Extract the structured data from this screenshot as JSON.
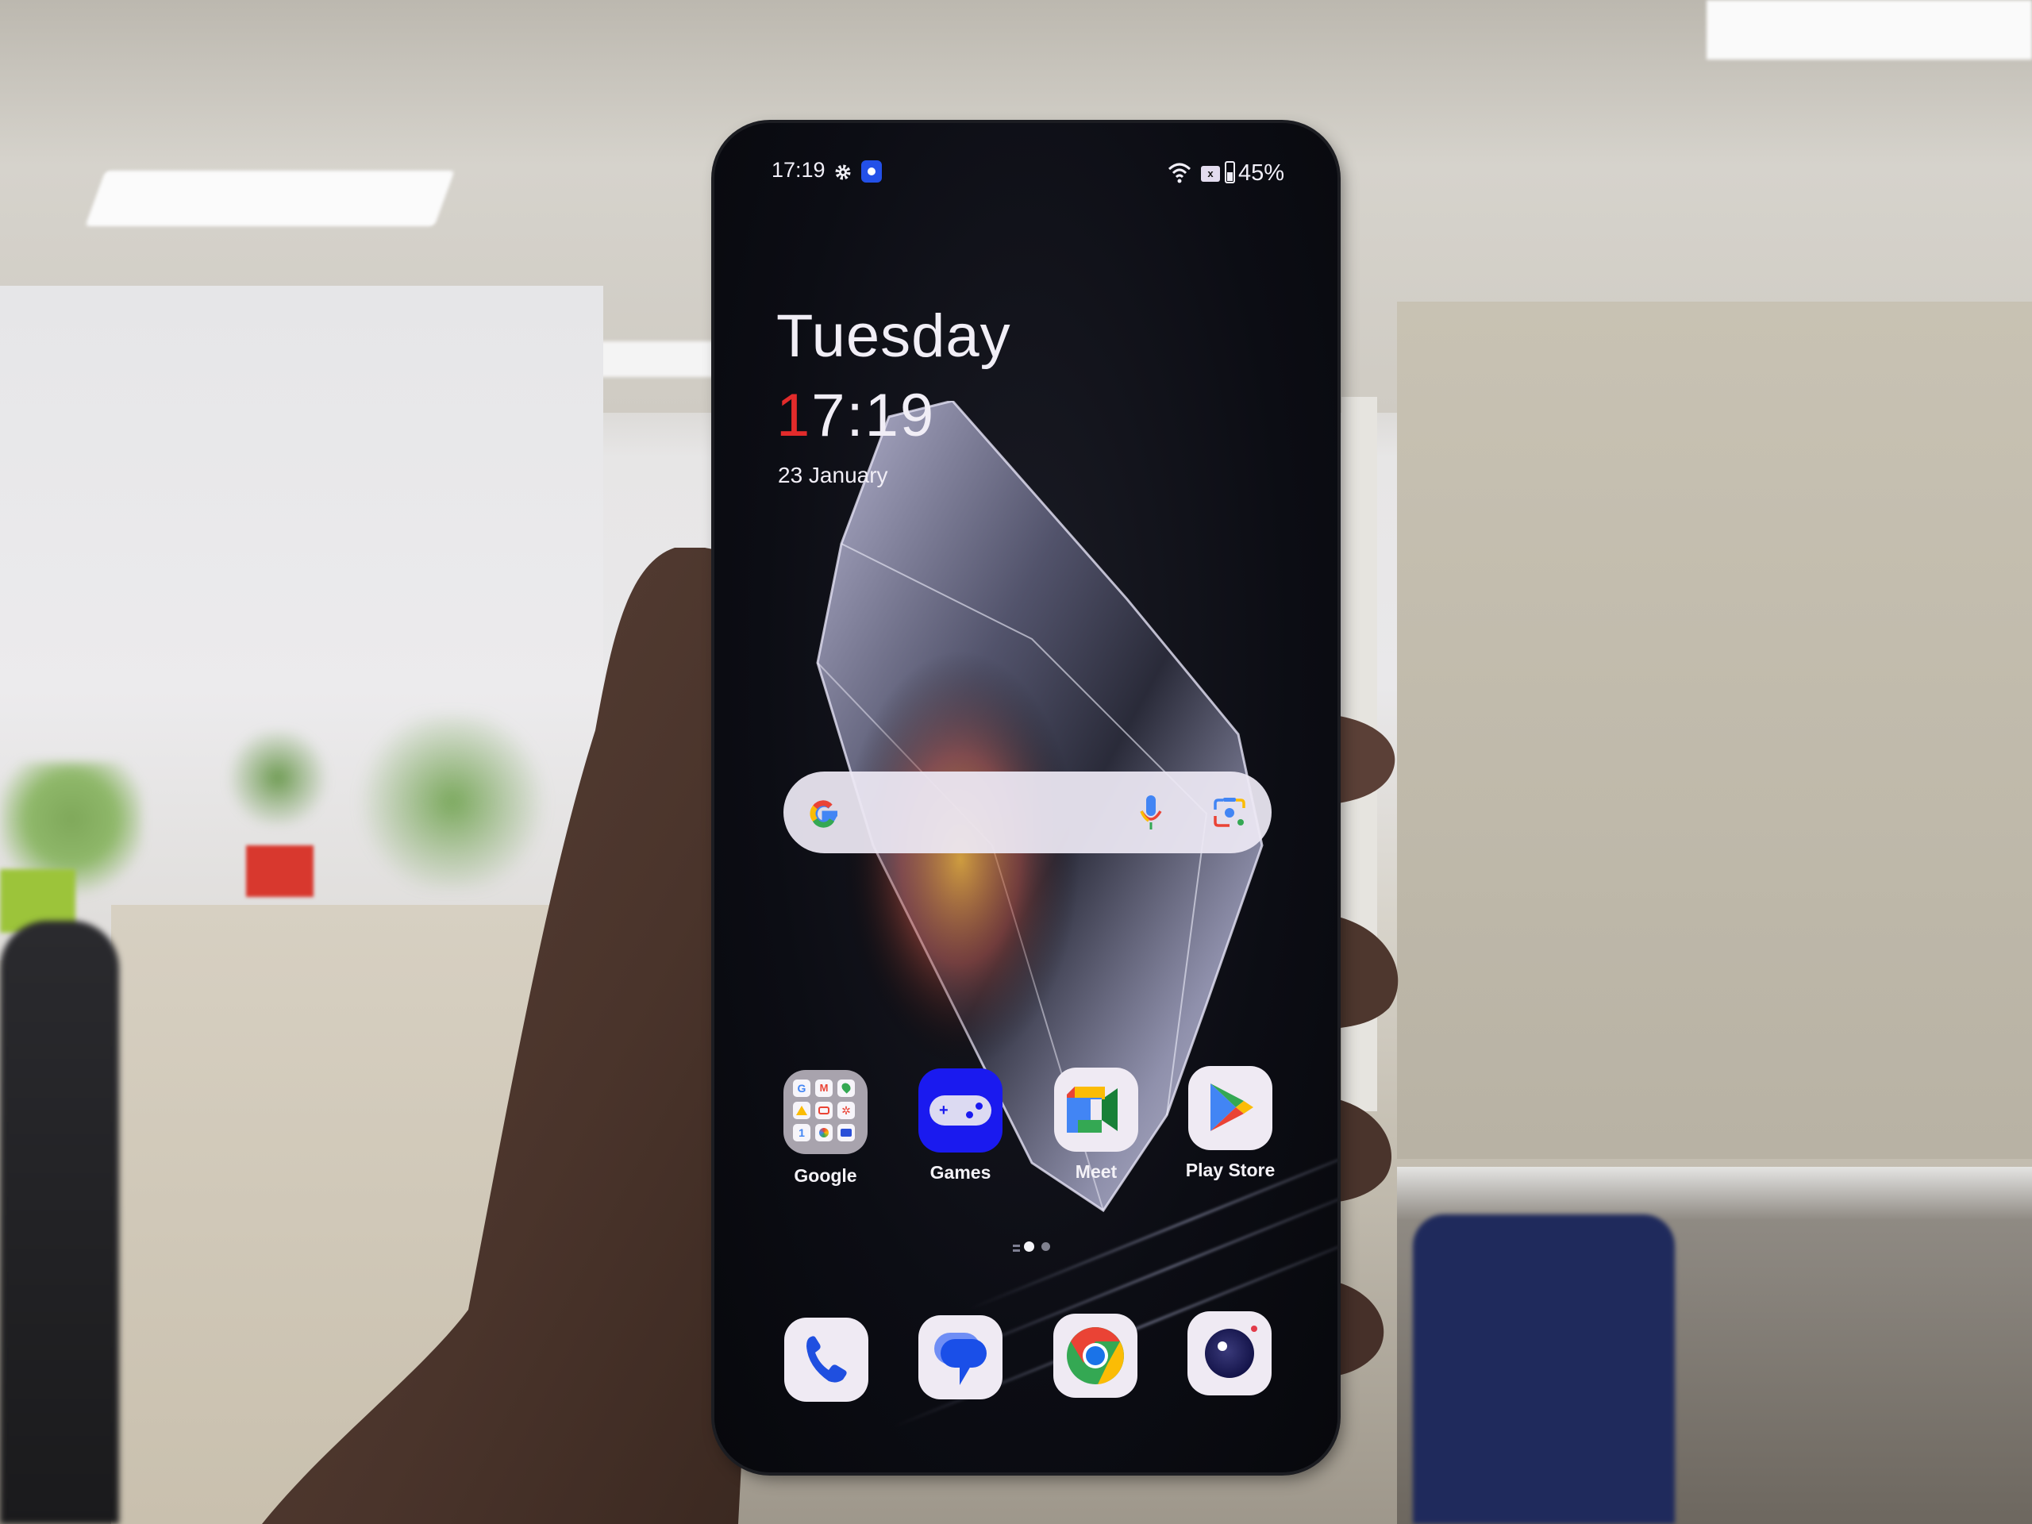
{
  "status_bar": {
    "time": "17:19",
    "left_icons": [
      "gear-icon",
      "app-notification-icon"
    ],
    "right_icons": [
      "wifi-icon",
      "sim-none-icon",
      "battery-icon"
    ],
    "battery_percent": "45%",
    "battery_level": 0.45
  },
  "clock_widget": {
    "day": "Tuesday",
    "time_first_digit": "1",
    "time_rest": "7:19",
    "date": "23 January",
    "accent_color": "#e32b2b"
  },
  "search_widget": {
    "logo": "google-g-icon",
    "voice_icon": "microphone-icon",
    "lens_icon": "google-lens-icon"
  },
  "home_apps": [
    {
      "label": "Google",
      "icon": "google-folder-icon"
    },
    {
      "label": "Games",
      "icon": "gamepad-icon",
      "color": "#1a1aef"
    },
    {
      "label": "Meet",
      "icon": "google-meet-icon"
    },
    {
      "label": "Play Store",
      "icon": "play-store-icon"
    }
  ],
  "page_indicator": {
    "pages": 2,
    "current": 1,
    "has_list_marker": true
  },
  "dock": [
    {
      "label": "Phone",
      "icon": "phone-icon"
    },
    {
      "label": "Messages",
      "icon": "messages-icon"
    },
    {
      "label": "Chrome",
      "icon": "chrome-icon"
    },
    {
      "label": "Camera",
      "icon": "camera-icon"
    }
  ]
}
